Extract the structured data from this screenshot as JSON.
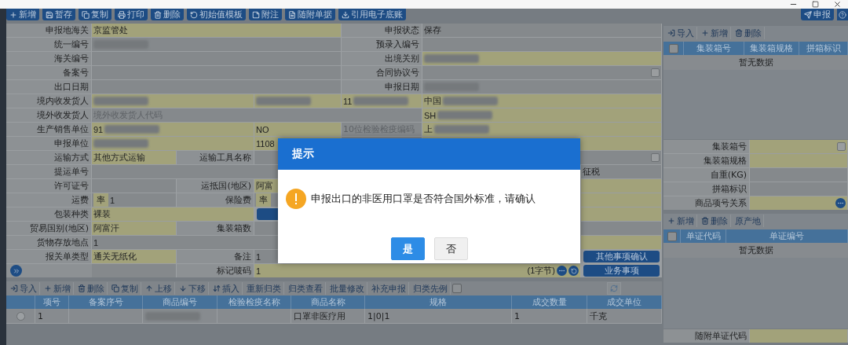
{
  "toolbar": {
    "left": [
      {
        "label": "新增"
      },
      {
        "label": "暂存"
      },
      {
        "label": "复制"
      },
      {
        "label": "打印"
      },
      {
        "label": "删除"
      },
      {
        "label": "初始值模板"
      },
      {
        "label": "附注"
      },
      {
        "label": "随附单据"
      },
      {
        "label": "引用电子底账"
      }
    ],
    "right": [
      {
        "label": "申报"
      }
    ]
  },
  "form": {
    "rows": [
      {
        "kind": "pair",
        "cells": [
          {
            "text": "申报地海关"
          },
          {
            "value": "京监管处",
            "required": true
          },
          {
            "text": "申报状态"
          },
          {
            "value": "保存",
            "required": false
          }
        ]
      },
      {
        "kind": "pair",
        "cells": [
          {
            "text": "统一编号"
          },
          {
            "required": false,
            "redacted": true
          },
          {
            "text": "预录入编号"
          },
          {
            "required": false
          }
        ]
      },
      {
        "kind": "pair",
        "cells": [
          {
            "text": "海关编号"
          },
          {
            "required": false
          },
          {
            "text": "出境关别"
          },
          {
            "required": true,
            "redacted": true
          }
        ]
      },
      {
        "kind": "pair",
        "cells": [
          {
            "text": "备案号"
          },
          {
            "required": false
          },
          {
            "text": "合同协议号"
          },
          {
            "required": false,
            "picker": true
          }
        ]
      },
      {
        "kind": "pair",
        "cells": [
          {
            "text": "出口日期"
          },
          {
            "required": false
          },
          {
            "text": "申报日期"
          },
          {
            "required": false,
            "redacted": true
          }
        ]
      },
      {
        "kind": "party",
        "cells": [
          {
            "text": "境内收发货人"
          },
          {
            "required": true,
            "redacted": true
          },
          {
            "required": true,
            "redacted": true
          },
          {
            "value": "11",
            "required": true,
            "redacted": true
          },
          {
            "value": "中国",
            "required": true,
            "redacted": true
          }
        ]
      },
      {
        "kind": "foreign",
        "cells": [
          {
            "text": "境外收发货人"
          },
          {
            "placeholder": "境外收发货人代码",
            "required": false
          },
          {
            "value": "SH",
            "required": true,
            "redacted": true
          }
        ]
      },
      {
        "kind": "party",
        "cells": [
          {
            "text": "生产销售单位"
          },
          {
            "value": "91",
            "required": true,
            "redacted": true
          },
          {
            "value": "NO",
            "required": true
          },
          {
            "placeholder": "10位检验检疫编码",
            "required": false
          },
          {
            "value": "上",
            "required": true,
            "redacted": true
          }
        ]
      },
      {
        "kind": "party",
        "cells": [
          {
            "text": "申报单位"
          },
          {
            "required": true,
            "redacted": true
          },
          {
            "value": "1108",
            "required": true
          },
          {},
          {
            "required": true
          }
        ]
      },
      {
        "kind": "transport",
        "cells": [
          {
            "text": "运输方式"
          },
          {
            "value": "其他方式运输",
            "required": true
          },
          {
            "text": "运输工具名称"
          },
          {
            "required": false,
            "picker": true
          }
        ]
      },
      {
        "kind": "wide",
        "cells": [
          {
            "text": "提运单号"
          },
          {
            "required": false
          },
          {
            "value": "征税",
            "required": false
          }
        ]
      },
      {
        "kind": "triple",
        "cells": [
          {
            "text": "许可证号"
          },
          {
            "required": false
          },
          {
            "text": "运抵国(地区)"
          },
          {
            "value": "阿富",
            "required": true
          },
          {},
          {
            "required": true
          }
        ]
      },
      {
        "kind": "triple",
        "cells": [
          {
            "text": "运费"
          },
          {
            "unit": "率",
            "value": "1",
            "required": false
          },
          {
            "text": "保险费"
          },
          {
            "unit": "率",
            "required": false
          },
          {},
          {
            "required": true
          }
        ]
      },
      {
        "kind": "packing",
        "cells": [
          {
            "text": "包装种类"
          },
          {
            "value": "裸装",
            "required": true
          },
          {},
          {},
          {
            "required": true
          }
        ]
      },
      {
        "kind": "triple",
        "cells": [
          {
            "text": "贸易国别(地区)"
          },
          {
            "value": "阿富汗",
            "required": true
          },
          {
            "text": "集装箱数"
          },
          {
            "required": false
          },
          {},
          {
            "required": false
          }
        ]
      },
      {
        "kind": "wide",
        "cells": [
          {
            "text": "货物存放地点"
          },
          {
            "value": "1",
            "required": false
          },
          {
            "required": true
          }
        ]
      },
      {
        "kind": "remark",
        "cells": [
          {
            "text": "报关单类型"
          },
          {
            "value": "通关无纸化",
            "required": true
          },
          {
            "text": "备注"
          },
          {
            "value": "1",
            "required": false
          },
          {
            "text": "其他事项确认"
          }
        ]
      },
      {
        "kind": "mark",
        "cells": [
          {},
          {
            "required": false
          },
          {
            "text": "标记唛码"
          },
          {
            "value": "1",
            "required": true,
            "suffix": "(1字节)"
          },
          {
            "text": "业务事项"
          }
        ]
      }
    ]
  },
  "goods": {
    "toolbar": [
      {
        "label": "导入"
      },
      {
        "label": "新增"
      },
      {
        "label": "删除"
      },
      {
        "label": "复制"
      },
      {
        "label": "上移"
      },
      {
        "label": "下移"
      },
      {
        "label": "插入"
      },
      {
        "label": "重新归类"
      },
      {
        "label": "归类查看"
      },
      {
        "label": "批量修改"
      },
      {
        "label": "补充申报"
      },
      {
        "label": "归类先例"
      }
    ],
    "precedent_checked": false,
    "columns": [
      "项号",
      "备案序号",
      "商品编号",
      "检验检疫名称",
      "商品名称",
      "规格",
      "成交数量",
      "成交单位"
    ],
    "rows": [
      {
        "selected": false,
        "cells": [
          {
            "text": "1"
          },
          {},
          {
            "redacted": true
          },
          {},
          {
            "text": "口罩非医疗用"
          },
          {
            "text": "1|0|1"
          },
          {
            "text": "1"
          },
          {
            "text": "千克"
          }
        ]
      }
    ]
  },
  "containers": {
    "toolbar": [
      {
        "label": "导入"
      },
      {
        "label": "新增"
      },
      {
        "label": "删除"
      }
    ],
    "all_checked": false,
    "columns": [
      "集装箱号",
      "集装箱规格",
      "拼箱标识"
    ],
    "empty_text": "暂无数据",
    "fields": [
      {
        "label": "集装箱号",
        "required": true,
        "picker": true
      },
      {
        "label": "集装箱规格",
        "required": true
      },
      {
        "label": "自重(KG)",
        "required": false
      },
      {
        "label": "拼箱标识",
        "required": false
      },
      {
        "label": "商品项号关系",
        "required": true,
        "more": true
      }
    ]
  },
  "documents": {
    "toolbar": [
      {
        "label": "新增"
      },
      {
        "label": "删除"
      },
      {
        "label": "原产地"
      }
    ],
    "all_checked": false,
    "columns": [
      "单证代码",
      "单证编号"
    ],
    "empty_text": "暂无数据",
    "fields": [
      {
        "label": "随附单证代码",
        "required": true
      }
    ]
  },
  "dialog": {
    "title": "提示",
    "message": "申报出口的非医用口罩是否符合国外标准，请确认",
    "buttons": [
      {
        "label": "是",
        "primary": true
      },
      {
        "label": "否",
        "primary": false
      }
    ]
  }
}
